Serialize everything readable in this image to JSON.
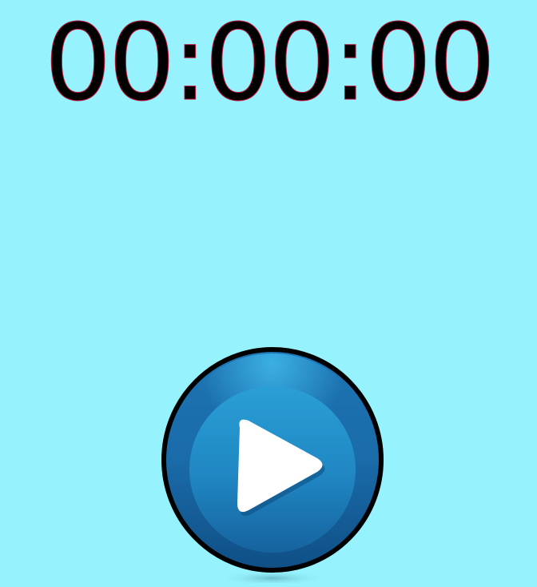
{
  "timer": {
    "display": "00:00:00"
  },
  "controls": {
    "play_icon": "play-icon"
  },
  "colors": {
    "background": "#96f3fd",
    "button_blue": "#1f85c0",
    "button_outline": "#000000"
  }
}
